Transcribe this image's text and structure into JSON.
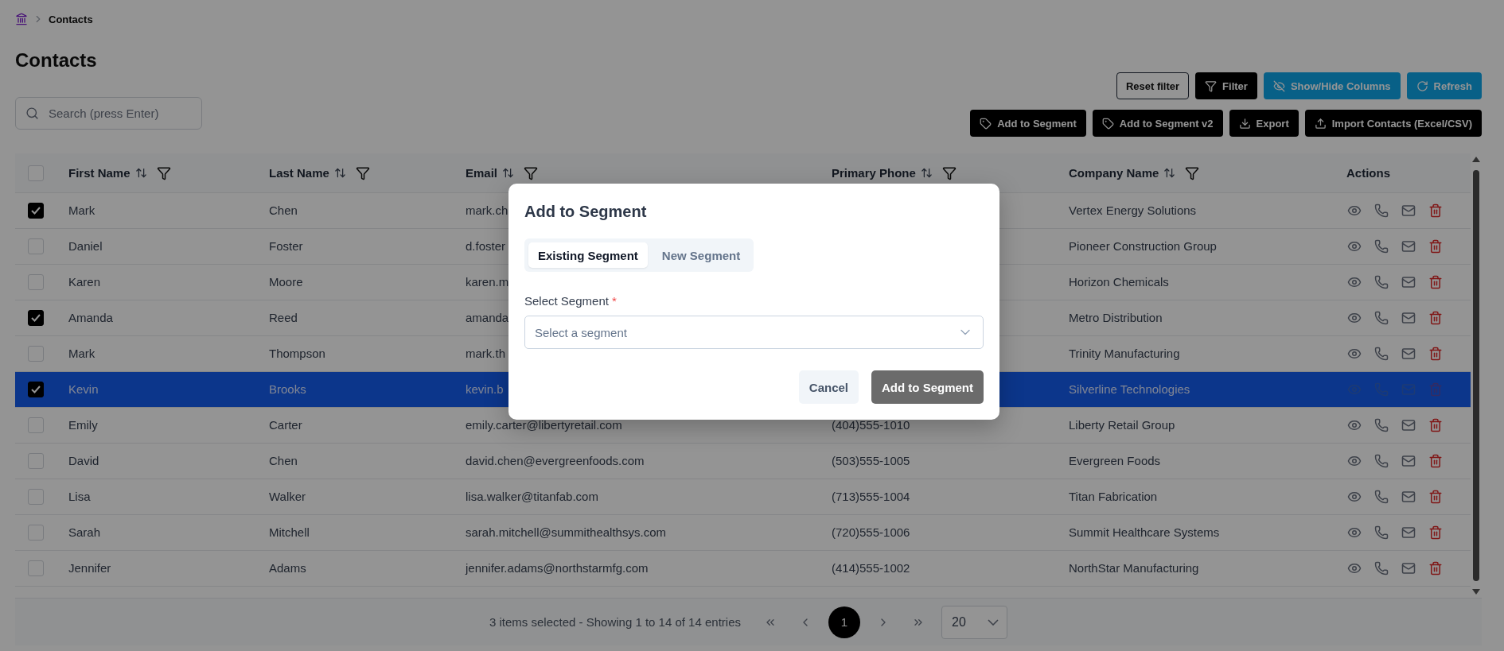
{
  "breadcrumb": {
    "current": "Contacts"
  },
  "page_title": "Contacts",
  "toolbar_top": [
    {
      "label": "Reset filter",
      "kind": "outline"
    },
    {
      "label": "Filter",
      "kind": "dark"
    },
    {
      "label": "Show/Hide Columns",
      "kind": "accent"
    },
    {
      "label": "Refresh",
      "kind": "accent"
    }
  ],
  "search": {
    "placeholder": "Search (press Enter)"
  },
  "toolbar_bottom": [
    {
      "label": "Add to Segment",
      "kind": "dark"
    },
    {
      "label": "Add to Segment v2",
      "kind": "dark"
    },
    {
      "label": "Export",
      "kind": "dark"
    },
    {
      "label": "Import Contacts (Excel/CSV)",
      "kind": "dark"
    }
  ],
  "table": {
    "all_checked": false,
    "columns": [
      {
        "label": "First Name",
        "kind": "sortable"
      },
      {
        "label": "Last Name",
        "kind": "sortable"
      },
      {
        "label": "Email",
        "kind": "sortable"
      },
      {
        "label": "Primary Phone",
        "kind": "sortable"
      },
      {
        "label": "Company Name",
        "kind": "sortable"
      },
      {
        "label": "Actions",
        "kind": "plain"
      }
    ],
    "rows": [
      {
        "first_name": "Mark",
        "last_name": "Chen",
        "email": "mark.ch",
        "company": "Vertex Energy Solutions",
        "checked": true,
        "selected": false
      },
      {
        "first_name": "Daniel",
        "last_name": "Foster",
        "email": "d.foster",
        "company": "Pioneer Construction Group",
        "checked": false,
        "selected": false
      },
      {
        "first_name": "Karen",
        "last_name": "Moore",
        "email": "karen.m",
        "company": "Horizon Chemicals",
        "checked": false,
        "selected": false
      },
      {
        "first_name": "Amanda",
        "last_name": "Reed",
        "email": "amanda",
        "company": "Metro Distribution",
        "checked": true,
        "selected": false
      },
      {
        "first_name": "Mark",
        "last_name": "Thompson",
        "email": "mark.th",
        "company": "Trinity Manufacturing",
        "checked": false,
        "selected": false
      },
      {
        "first_name": "Kevin",
        "last_name": "Brooks",
        "email": "kevin.b",
        "company": "Silverline Technologies",
        "checked": true,
        "selected": true
      },
      {
        "first_name": "Emily",
        "last_name": "Carter",
        "email": "emily.carter@libertyretail.com",
        "phone": "(404)555-1010",
        "company": "Liberty Retail Group",
        "checked": false,
        "selected": false
      },
      {
        "first_name": "David",
        "last_name": "Chen",
        "email": "david.chen@evergreenfoods.com",
        "phone": "(503)555-1005",
        "company": "Evergreen Foods",
        "checked": false,
        "selected": false
      },
      {
        "first_name": "Lisa",
        "last_name": "Walker",
        "email": "lisa.walker@titanfab.com",
        "phone": "(713)555-1004",
        "company": "Titan Fabrication",
        "checked": false,
        "selected": false
      },
      {
        "first_name": "Sarah",
        "last_name": "Mitchell",
        "email": "sarah.mitchell@summithealthsys.com",
        "phone": "(720)555-1006",
        "company": "Summit Healthcare Systems",
        "checked": false,
        "selected": false
      },
      {
        "first_name": "Jennifer",
        "last_name": "Adams",
        "email": "jennifer.adams@northstarmfg.com",
        "phone": "(414)555-1002",
        "company": "NorthStar Manufacturing",
        "checked": false,
        "selected": false
      }
    ]
  },
  "pagination": {
    "summary": "3 items selected - Showing 1 to 14 of 14 entries",
    "pages": [
      {
        "label": "1",
        "selected": true
      }
    ],
    "page_size": "20"
  },
  "modal": {
    "title": "Add to Segment",
    "tabs": [
      {
        "label": "Existing Segment",
        "selected": true
      },
      {
        "label": "New Segment",
        "selected": false
      }
    ],
    "field": {
      "label": "Select Segment",
      "required_mark": "*",
      "placeholder": "Select a segment"
    },
    "buttons": [
      {
        "label": "Cancel",
        "kind": "secondary",
        "disabled": false
      },
      {
        "label": "Add to Segment",
        "kind": "primary",
        "disabled": true
      }
    ]
  }
}
